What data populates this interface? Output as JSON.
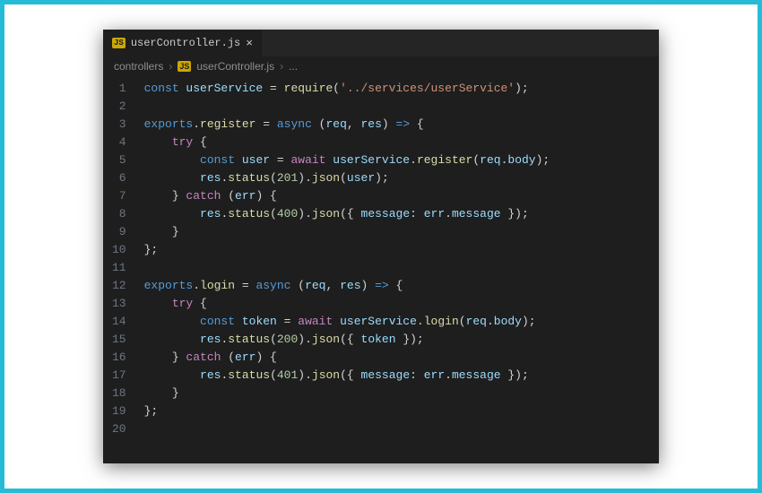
{
  "tab": {
    "badge": "JS",
    "filename": "userController.js",
    "close": "×"
  },
  "breadcrumbs": {
    "folder": "controllers",
    "sep": "›",
    "badge": "JS",
    "file": "userController.js",
    "trail": "..."
  },
  "code": {
    "lines": [
      [
        {
          "t": "const ",
          "c": "tok-kw2"
        },
        {
          "t": "userService",
          "c": "tok-var"
        },
        {
          "t": " = ",
          "c": "tok-op"
        },
        {
          "t": "require",
          "c": "tok-fn"
        },
        {
          "t": "(",
          "c": "tok-pun"
        },
        {
          "t": "'../services/userService'",
          "c": "tok-str"
        },
        {
          "t": ");",
          "c": "tok-pun"
        }
      ],
      [],
      [
        {
          "t": "exports",
          "c": "tok-kw2"
        },
        {
          "t": ".",
          "c": "tok-pun"
        },
        {
          "t": "register",
          "c": "tok-fn"
        },
        {
          "t": " = ",
          "c": "tok-op"
        },
        {
          "t": "async",
          "c": "tok-kw2"
        },
        {
          "t": " (",
          "c": "tok-pun"
        },
        {
          "t": "req",
          "c": "tok-var"
        },
        {
          "t": ", ",
          "c": "tok-pun"
        },
        {
          "t": "res",
          "c": "tok-var"
        },
        {
          "t": ") ",
          "c": "tok-pun"
        },
        {
          "t": "=>",
          "c": "tok-kw2"
        },
        {
          "t": " {",
          "c": "tok-pun"
        }
      ],
      [
        {
          "t": "    ",
          "c": ""
        },
        {
          "t": "try",
          "c": "tok-kw"
        },
        {
          "t": " {",
          "c": "tok-pun"
        }
      ],
      [
        {
          "t": "        ",
          "c": ""
        },
        {
          "t": "const ",
          "c": "tok-kw2"
        },
        {
          "t": "user",
          "c": "tok-var"
        },
        {
          "t": " = ",
          "c": "tok-op"
        },
        {
          "t": "await",
          "c": "tok-kw"
        },
        {
          "t": " ",
          "c": ""
        },
        {
          "t": "userService",
          "c": "tok-var"
        },
        {
          "t": ".",
          "c": "tok-pun"
        },
        {
          "t": "register",
          "c": "tok-fn"
        },
        {
          "t": "(",
          "c": "tok-pun"
        },
        {
          "t": "req",
          "c": "tok-var"
        },
        {
          "t": ".",
          "c": "tok-pun"
        },
        {
          "t": "body",
          "c": "tok-prop"
        },
        {
          "t": ");",
          "c": "tok-pun"
        }
      ],
      [
        {
          "t": "        ",
          "c": ""
        },
        {
          "t": "res",
          "c": "tok-var"
        },
        {
          "t": ".",
          "c": "tok-pun"
        },
        {
          "t": "status",
          "c": "tok-fn"
        },
        {
          "t": "(",
          "c": "tok-pun"
        },
        {
          "t": "201",
          "c": "tok-num"
        },
        {
          "t": ").",
          "c": "tok-pun"
        },
        {
          "t": "json",
          "c": "tok-fn"
        },
        {
          "t": "(",
          "c": "tok-pun"
        },
        {
          "t": "user",
          "c": "tok-var"
        },
        {
          "t": ");",
          "c": "tok-pun"
        }
      ],
      [
        {
          "t": "    } ",
          "c": "tok-pun"
        },
        {
          "t": "catch",
          "c": "tok-kw"
        },
        {
          "t": " (",
          "c": "tok-pun"
        },
        {
          "t": "err",
          "c": "tok-var"
        },
        {
          "t": ") {",
          "c": "tok-pun"
        }
      ],
      [
        {
          "t": "        ",
          "c": ""
        },
        {
          "t": "res",
          "c": "tok-var"
        },
        {
          "t": ".",
          "c": "tok-pun"
        },
        {
          "t": "status",
          "c": "tok-fn"
        },
        {
          "t": "(",
          "c": "tok-pun"
        },
        {
          "t": "400",
          "c": "tok-num"
        },
        {
          "t": ").",
          "c": "tok-pun"
        },
        {
          "t": "json",
          "c": "tok-fn"
        },
        {
          "t": "({ ",
          "c": "tok-pun"
        },
        {
          "t": "message",
          "c": "tok-prop"
        },
        {
          "t": ": ",
          "c": "tok-pun"
        },
        {
          "t": "err",
          "c": "tok-var"
        },
        {
          "t": ".",
          "c": "tok-pun"
        },
        {
          "t": "message",
          "c": "tok-prop"
        },
        {
          "t": " });",
          "c": "tok-pun"
        }
      ],
      [
        {
          "t": "    }",
          "c": "tok-pun"
        }
      ],
      [
        {
          "t": "};",
          "c": "tok-pun"
        }
      ],
      [],
      [
        {
          "t": "exports",
          "c": "tok-kw2"
        },
        {
          "t": ".",
          "c": "tok-pun"
        },
        {
          "t": "login",
          "c": "tok-fn"
        },
        {
          "t": " = ",
          "c": "tok-op"
        },
        {
          "t": "async",
          "c": "tok-kw2"
        },
        {
          "t": " (",
          "c": "tok-pun"
        },
        {
          "t": "req",
          "c": "tok-var"
        },
        {
          "t": ", ",
          "c": "tok-pun"
        },
        {
          "t": "res",
          "c": "tok-var"
        },
        {
          "t": ") ",
          "c": "tok-pun"
        },
        {
          "t": "=>",
          "c": "tok-kw2"
        },
        {
          "t": " {",
          "c": "tok-pun"
        }
      ],
      [
        {
          "t": "    ",
          "c": ""
        },
        {
          "t": "try",
          "c": "tok-kw"
        },
        {
          "t": " {",
          "c": "tok-pun"
        }
      ],
      [
        {
          "t": "        ",
          "c": ""
        },
        {
          "t": "const ",
          "c": "tok-kw2"
        },
        {
          "t": "token",
          "c": "tok-var"
        },
        {
          "t": " = ",
          "c": "tok-op"
        },
        {
          "t": "await",
          "c": "tok-kw"
        },
        {
          "t": " ",
          "c": ""
        },
        {
          "t": "userService",
          "c": "tok-var"
        },
        {
          "t": ".",
          "c": "tok-pun"
        },
        {
          "t": "login",
          "c": "tok-fn"
        },
        {
          "t": "(",
          "c": "tok-pun"
        },
        {
          "t": "req",
          "c": "tok-var"
        },
        {
          "t": ".",
          "c": "tok-pun"
        },
        {
          "t": "body",
          "c": "tok-prop"
        },
        {
          "t": ");",
          "c": "tok-pun"
        }
      ],
      [
        {
          "t": "        ",
          "c": ""
        },
        {
          "t": "res",
          "c": "tok-var"
        },
        {
          "t": ".",
          "c": "tok-pun"
        },
        {
          "t": "status",
          "c": "tok-fn"
        },
        {
          "t": "(",
          "c": "tok-pun"
        },
        {
          "t": "200",
          "c": "tok-num"
        },
        {
          "t": ").",
          "c": "tok-pun"
        },
        {
          "t": "json",
          "c": "tok-fn"
        },
        {
          "t": "({ ",
          "c": "tok-pun"
        },
        {
          "t": "token",
          "c": "tok-prop"
        },
        {
          "t": " });",
          "c": "tok-pun"
        }
      ],
      [
        {
          "t": "    } ",
          "c": "tok-pun"
        },
        {
          "t": "catch",
          "c": "tok-kw"
        },
        {
          "t": " (",
          "c": "tok-pun"
        },
        {
          "t": "err",
          "c": "tok-var"
        },
        {
          "t": ") {",
          "c": "tok-pun"
        }
      ],
      [
        {
          "t": "        ",
          "c": ""
        },
        {
          "t": "res",
          "c": "tok-var"
        },
        {
          "t": ".",
          "c": "tok-pun"
        },
        {
          "t": "status",
          "c": "tok-fn"
        },
        {
          "t": "(",
          "c": "tok-pun"
        },
        {
          "t": "401",
          "c": "tok-num"
        },
        {
          "t": ").",
          "c": "tok-pun"
        },
        {
          "t": "json",
          "c": "tok-fn"
        },
        {
          "t": "({ ",
          "c": "tok-pun"
        },
        {
          "t": "message",
          "c": "tok-prop"
        },
        {
          "t": ": ",
          "c": "tok-pun"
        },
        {
          "t": "err",
          "c": "tok-var"
        },
        {
          "t": ".",
          "c": "tok-pun"
        },
        {
          "t": "message",
          "c": "tok-prop"
        },
        {
          "t": " });",
          "c": "tok-pun"
        }
      ],
      [
        {
          "t": "    }",
          "c": "tok-pun"
        }
      ],
      [
        {
          "t": "};",
          "c": "tok-pun"
        }
      ],
      []
    ]
  }
}
